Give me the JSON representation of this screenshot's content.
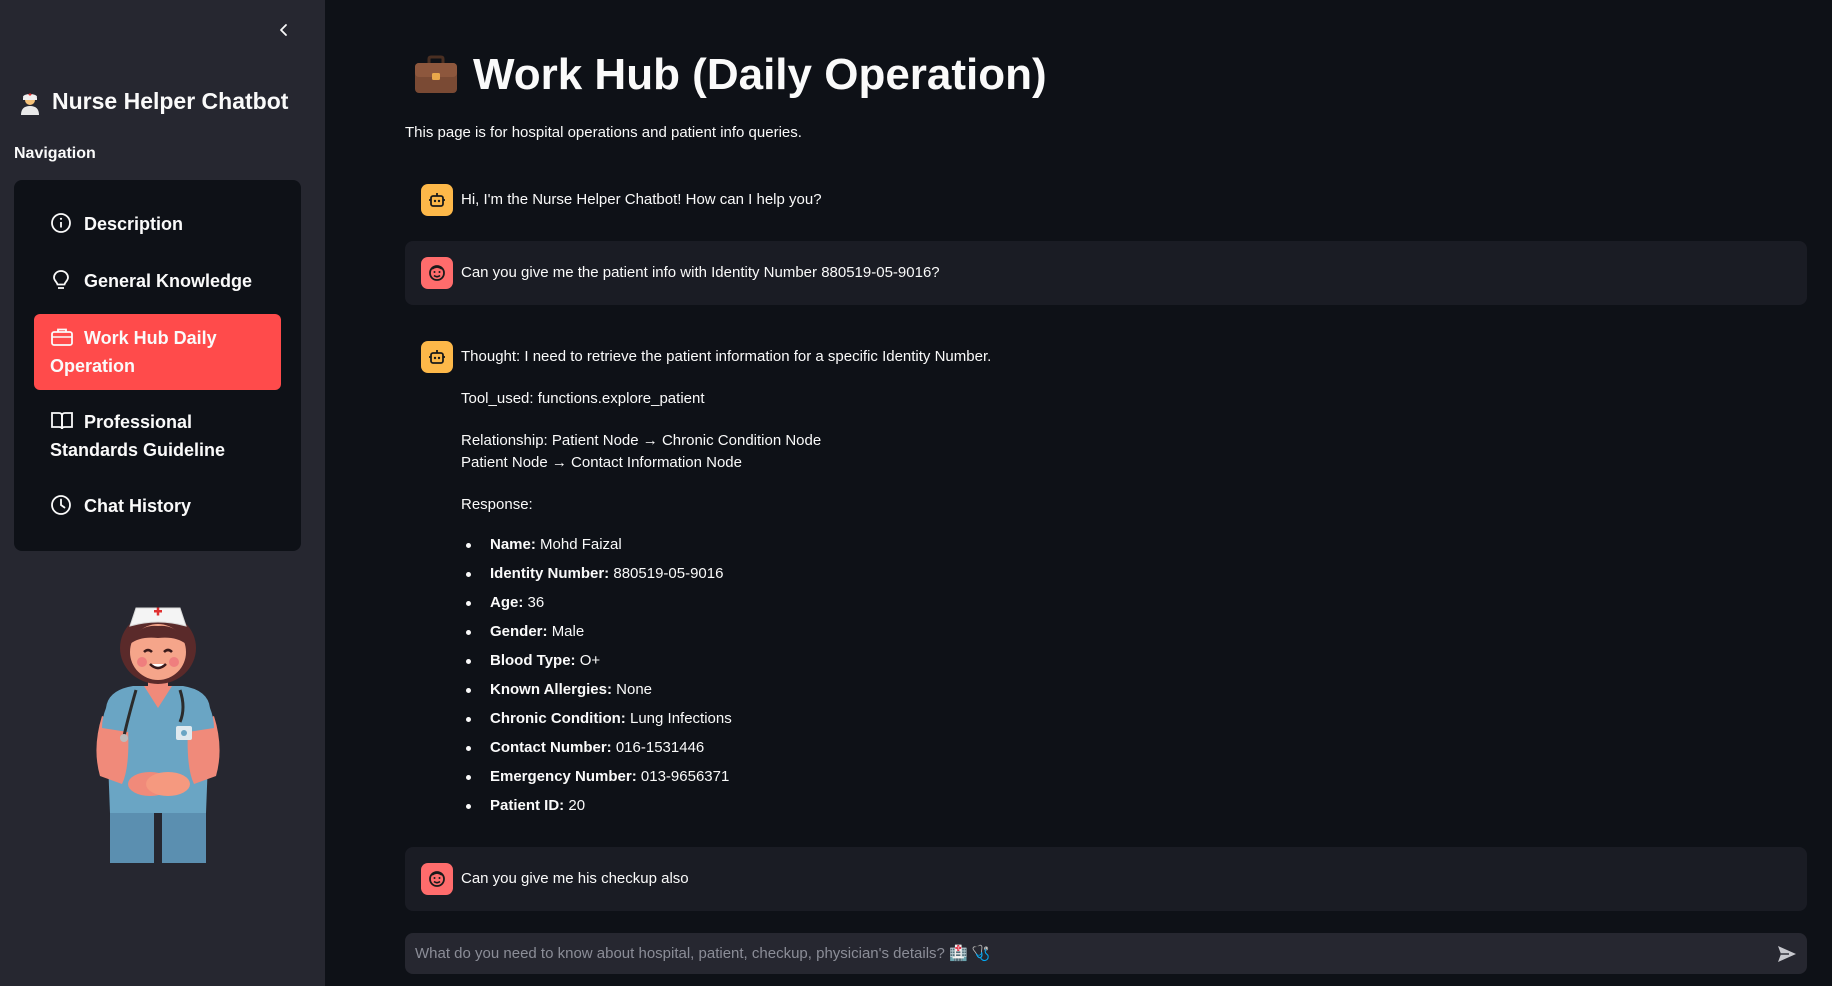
{
  "sidebar": {
    "app_title": "Nurse Helper Chatbot",
    "nav_label": "Navigation",
    "items": [
      {
        "label": "Description",
        "icon": "info-circle-icon"
      },
      {
        "label": "General Knowledge",
        "icon": "lightbulb-icon"
      },
      {
        "label": "Work Hub Daily Operation",
        "icon": "briefcase-icon",
        "active": true
      },
      {
        "label": "Professional Standards Guideline",
        "icon": "book-icon"
      },
      {
        "label": "Chat History",
        "icon": "clock-icon"
      }
    ],
    "accent_color": "#ff4b4b"
  },
  "main": {
    "title": "Work Hub (Daily Operation)",
    "subtitle": "This page is for hospital operations and patient info queries.",
    "messages": [
      {
        "role": "assistant",
        "text": "Hi, I'm the Nurse Helper Chatbot! How can I help you?"
      },
      {
        "role": "user",
        "text": "Can you give me the patient info with Identity Number 880519-05-9016?"
      },
      {
        "role": "assistant",
        "thought": "Thought: I need to retrieve the patient information for a specific Identity Number.",
        "tool_used": "Tool_used: functions.explore_patient",
        "relationship_line1": "Relationship: Patient Node → Chronic Condition Node",
        "relationship_line2": "Patient Node → Contact Information Node",
        "response_label": "Response:",
        "fields": [
          {
            "label": "Name:",
            "value": "Mohd Faizal"
          },
          {
            "label": "Identity Number:",
            "value": "880519-05-9016"
          },
          {
            "label": "Age:",
            "value": "36"
          },
          {
            "label": "Gender:",
            "value": "Male"
          },
          {
            "label": "Blood Type:",
            "value": "O+"
          },
          {
            "label": "Known Allergies:",
            "value": "None"
          },
          {
            "label": "Chronic Condition:",
            "value": "Lung Infections"
          },
          {
            "label": "Contact Number:",
            "value": "016-1531446"
          },
          {
            "label": "Emergency Number:",
            "value": "013-9656371"
          },
          {
            "label": "Patient ID:",
            "value": "20"
          }
        ]
      },
      {
        "role": "user",
        "text": "Can you give me his checkup also"
      }
    ],
    "input_placeholder": "What do you need to know about hospital, patient, checkup, physician's details? 🏥 🩺"
  }
}
